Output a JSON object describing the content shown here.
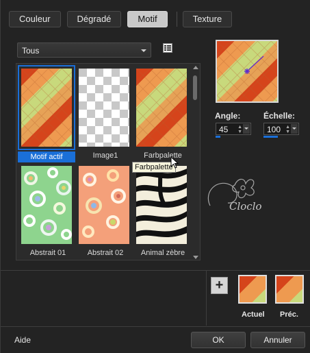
{
  "tabs": [
    {
      "label": "Couleur",
      "active": false
    },
    {
      "label": "Dégradé",
      "active": false
    },
    {
      "label": "Motif",
      "active": true
    },
    {
      "label": "Texture",
      "active": false
    }
  ],
  "filter": {
    "selected": "Tous"
  },
  "patterns": [
    {
      "label": "Motif actif",
      "selected": true,
      "kind": "diagonal-orange-green"
    },
    {
      "label": "Image1",
      "selected": false,
      "kind": "transparency-checker"
    },
    {
      "label": "Farbpalette",
      "selected": false,
      "kind": "diagonal-orange-green"
    },
    {
      "label": "Abstrait 01",
      "selected": false,
      "kind": "green-circles"
    },
    {
      "label": "Abstrait 02",
      "selected": false,
      "kind": "orange-circles"
    },
    {
      "label": "Animal zèbre",
      "selected": false,
      "kind": "zebra"
    }
  ],
  "tooltip": "Farbpalette",
  "angle": {
    "label": "Angle:",
    "value": "45",
    "fill_fraction": 0.13
  },
  "scale": {
    "label": "Échelle:",
    "value": "100",
    "fill_fraction": 0.4
  },
  "swatches": {
    "current": "Actuel",
    "previous": "Préc."
  },
  "footer": {
    "help": "Aide",
    "ok": "OK",
    "cancel": "Annuler"
  },
  "colors": {
    "accent": "#1a6fd8",
    "orange": "#e8893f",
    "red": "#d9461a",
    "green": "#c4d87a"
  }
}
